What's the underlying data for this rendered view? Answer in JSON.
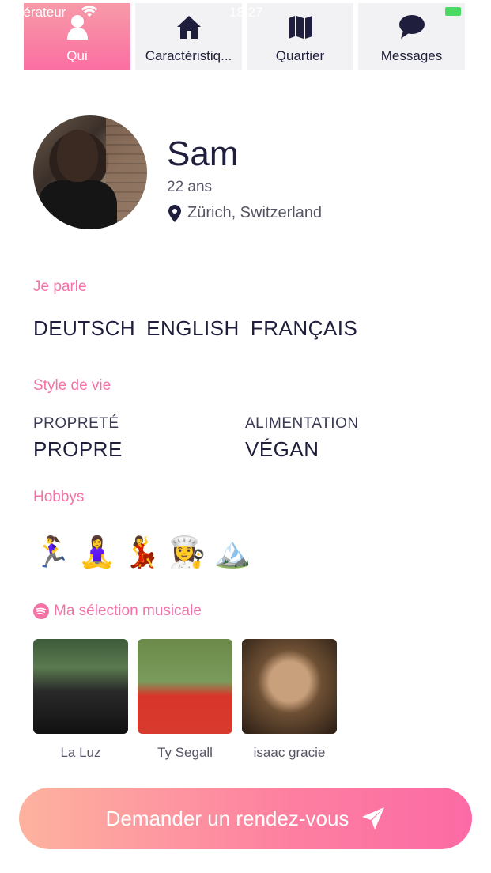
{
  "status_bar": {
    "carrier": "pérateur",
    "time": "18:27"
  },
  "tabs": [
    {
      "label": "Qui",
      "icon": "person-icon",
      "active": true
    },
    {
      "label": "Caractéristiq...",
      "icon": "house-icon",
      "active": false
    },
    {
      "label": "Quartier",
      "icon": "map-icon",
      "active": false
    },
    {
      "label": "Messages",
      "icon": "chat-bubble-icon",
      "active": false
    }
  ],
  "profile": {
    "name": "Sam",
    "age": "22 ans",
    "location": "Zürich, Switzerland"
  },
  "languages": {
    "title": "Je parle",
    "items": [
      "DEUTSCH",
      "ENGLISH",
      "FRANÇAIS"
    ]
  },
  "lifestyle": {
    "title": "Style de vie",
    "cleanliness_label": "PROPRETÉ",
    "cleanliness_value": "PROPRE",
    "diet_label": "ALIMENTATION",
    "diet_value": "VÉGAN"
  },
  "hobbies": {
    "title": "Hobbys",
    "items": [
      "🏃‍♀️",
      "🧘‍♀️",
      "💃",
      "👩‍🍳",
      "🏔️"
    ]
  },
  "music": {
    "title": "Ma sélection musicale",
    "albums": [
      "La Luz",
      "Ty Segall",
      "isaac gracie"
    ]
  },
  "cta": {
    "label": "Demander un rendez-vous"
  },
  "colors": {
    "accent_pink": "#f472a6",
    "tab_active_gradient_start": "#f79aa8",
    "tab_active_gradient_end": "#fb6fa2",
    "cta_gradient_start": "#fdb39f",
    "cta_gradient_end": "#fc6aa5",
    "text_dark": "#1f1f3d"
  }
}
